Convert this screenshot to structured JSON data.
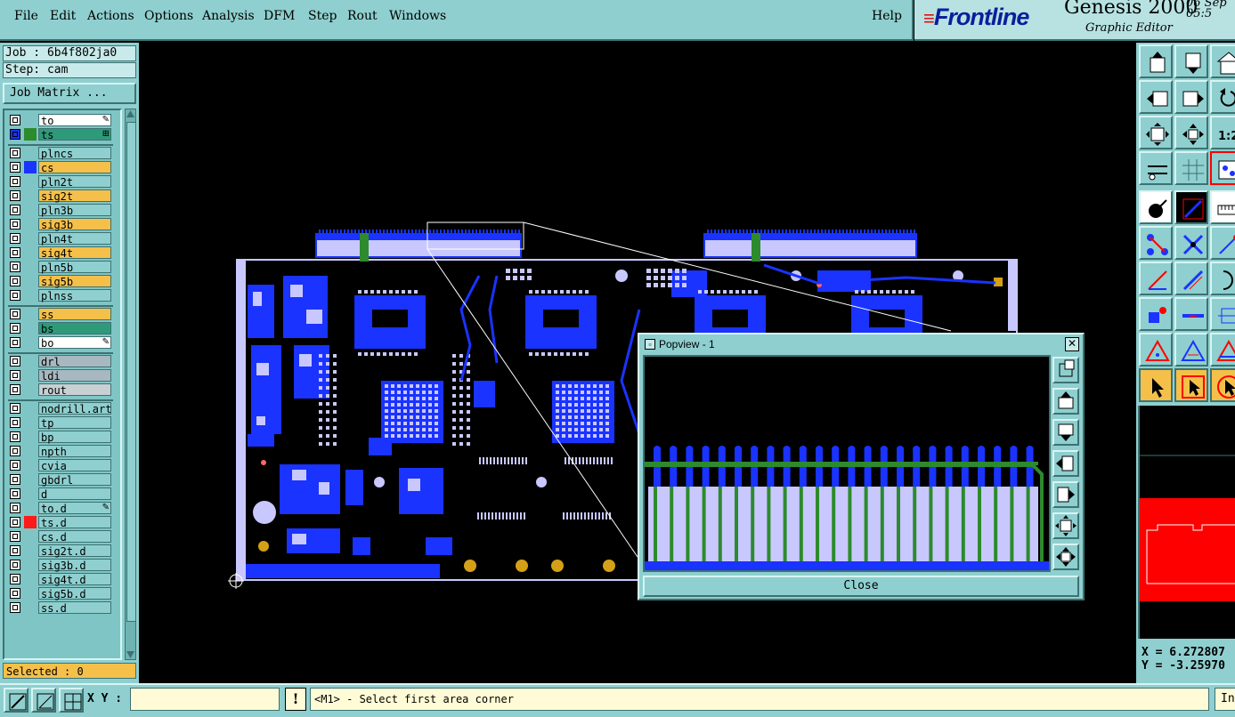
{
  "menu": {
    "items": [
      {
        "label": "File"
      },
      {
        "label": "Edit"
      },
      {
        "label": "Actions"
      },
      {
        "label": "Options"
      },
      {
        "label": "Analysis"
      },
      {
        "label": "DFM"
      },
      {
        "label": "Step"
      },
      {
        "label": "Rout"
      },
      {
        "label": "Windows"
      }
    ],
    "help": "Help"
  },
  "brand": {
    "logo": "Frontline",
    "product": "Genesis 2000",
    "subtitle": "Graphic Editor",
    "date_top": "06  Sep",
    "date_bottom": "05:5"
  },
  "job": {
    "job_label": "Job : 6b4f802ja0",
    "step_label": "Step: cam",
    "matrix_button": "Job Matrix ..."
  },
  "layers": [
    {
      "name": "to",
      "swatch": "",
      "name_bg": "#ffffff",
      "flag": "pencil-icon"
    },
    {
      "name": "ts",
      "swatch": "#2d8a2d",
      "name_bg": "#2f9a7a",
      "flag": "grid-icon",
      "selected_cb": true
    },
    {
      "name": "plncs",
      "swatch": "",
      "name_bg": "#8fcfcf"
    },
    {
      "name": "cs",
      "swatch": "#1a33ff",
      "name_bg": "#f5c04a"
    },
    {
      "name": "pln2t",
      "swatch": "",
      "name_bg": "#8fcfcf"
    },
    {
      "name": "sig2t",
      "swatch": "",
      "name_bg": "#f5c04a"
    },
    {
      "name": "pln3b",
      "swatch": "",
      "name_bg": "#8fcfcf"
    },
    {
      "name": "sig3b",
      "swatch": "",
      "name_bg": "#f5c04a"
    },
    {
      "name": "pln4t",
      "swatch": "",
      "name_bg": "#8fcfcf"
    },
    {
      "name": "sig4t",
      "swatch": "",
      "name_bg": "#f5c04a"
    },
    {
      "name": "pln5b",
      "swatch": "",
      "name_bg": "#8fcfcf"
    },
    {
      "name": "sig5b",
      "swatch": "",
      "name_bg": "#f5c04a"
    },
    {
      "name": "plnss",
      "swatch": "",
      "name_bg": "#8fcfcf"
    },
    {
      "name": "ss",
      "swatch": "",
      "name_bg": "#f5c04a"
    },
    {
      "name": "bs",
      "swatch": "",
      "name_bg": "#2f9a7a"
    },
    {
      "name": "bo",
      "swatch": "",
      "name_bg": "#ffffff",
      "flag": "pencil-icon"
    },
    {
      "name": "drl",
      "swatch": "",
      "name_bg": "#a8b8c0"
    },
    {
      "name": "ldi",
      "swatch": "",
      "name_bg": "#a8b8c0"
    },
    {
      "name": "rout",
      "swatch": "",
      "name_bg": "#c8d0d4"
    },
    {
      "name": "nodrill.art",
      "swatch": "",
      "name_bg": "#8fcfcf"
    },
    {
      "name": "tp",
      "swatch": "",
      "name_bg": "#8fcfcf"
    },
    {
      "name": "bp",
      "swatch": "",
      "name_bg": "#8fcfcf"
    },
    {
      "name": "npth",
      "swatch": "",
      "name_bg": "#8fcfcf"
    },
    {
      "name": "cvia",
      "swatch": "",
      "name_bg": "#8fcfcf"
    },
    {
      "name": "gbdrl",
      "swatch": "",
      "name_bg": "#8fcfcf"
    },
    {
      "name": "d",
      "swatch": "",
      "name_bg": "#8fcfcf"
    },
    {
      "name": "to.d",
      "swatch": "",
      "name_bg": "#8fcfcf",
      "flag": "pencil-icon"
    },
    {
      "name": "ts.d",
      "swatch": "#ff1a1a",
      "name_bg": "#8fcfcf"
    },
    {
      "name": "cs.d",
      "swatch": "",
      "name_bg": "#8fcfcf"
    },
    {
      "name": "sig2t.d",
      "swatch": "",
      "name_bg": "#8fcfcf"
    },
    {
      "name": "sig3b.d",
      "swatch": "",
      "name_bg": "#8fcfcf"
    },
    {
      "name": "sig4t.d",
      "swatch": "",
      "name_bg": "#8fcfcf"
    },
    {
      "name": "sig5b.d",
      "swatch": "",
      "name_bg": "#8fcfcf"
    },
    {
      "name": "ss.d",
      "swatch": "",
      "name_bg": "#8fcfcf"
    }
  ],
  "selected": "Selected : 0",
  "popview": {
    "title": "Popview - 1",
    "close_label": "Close"
  },
  "coords": {
    "x": "X = 6.272807",
    "y": "Y = -3.25970"
  },
  "status": {
    "xy_label": "X Y :",
    "xy_value": "",
    "warn": "!",
    "message": "<M1> - Select first area corner",
    "info_button": "In"
  },
  "colors": {
    "panel": "#8fcfcf",
    "copper": "#1a33ff",
    "pad": "#c8c8ff",
    "mask": "#2d8a2d",
    "gold": "#d4a017",
    "highlight": "#ff0000"
  }
}
